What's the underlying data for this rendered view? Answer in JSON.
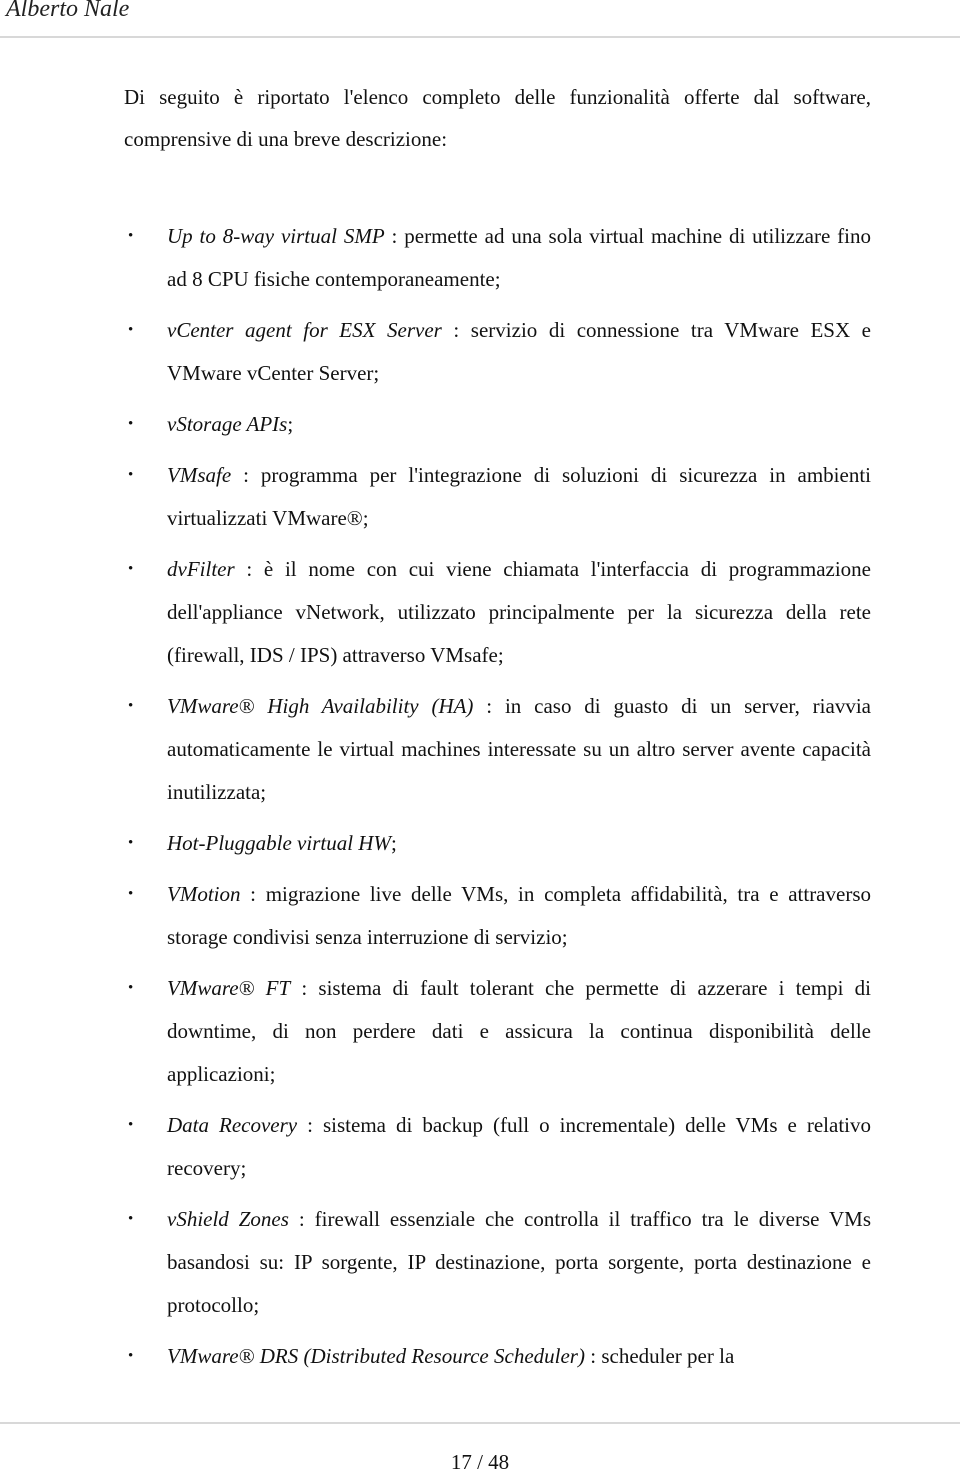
{
  "header": {
    "author": "Alberto Nale"
  },
  "intro": "Di seguito è riportato l'elenco completo delle funzionalità offerte dal software, comprensive di una breve descrizione:",
  "features": [
    {
      "term": "Up to 8-way virtual SMP",
      "sep": " : ",
      "desc": "permette ad una sola virtual machine di utilizzare fino ad 8 CPU fisiche contemporaneamente;"
    },
    {
      "term": "vCenter agent for ESX Server",
      "sep": " : ",
      "desc": "servizio di connessione tra VMware ESX e VMware vCenter Server;"
    },
    {
      "term": "vStorage APIs",
      "sep": "",
      "desc": ";"
    },
    {
      "term": "VMsafe",
      "sep": " : ",
      "desc": "programma per l'integrazione di soluzioni di sicurezza in ambienti virtualizzati VMware®;"
    },
    {
      "term": "dvFilter",
      "sep": " : ",
      "desc": "è il nome con cui viene chiamata l'interfaccia di programmazione dell'appliance vNetwork, utilizzato principalmente per la sicurezza della rete (firewall, IDS / IPS) attraverso VMsafe;"
    },
    {
      "term": "VMware® High Availability (HA)",
      "sep": " : ",
      "desc": "in caso di guasto di un server, riavvia automaticamente le virtual machines interessate su un altro server avente capacità inutilizzata;"
    },
    {
      "term": "Hot-Pluggable virtual HW",
      "sep": "",
      "desc": ";"
    },
    {
      "term": "VMotion",
      "sep": " : ",
      "desc": "migrazione live delle VMs, in completa affidabilità, tra e attraverso storage condivisi senza interruzione di servizio;"
    },
    {
      "term": "VMware® FT",
      "sep": " : ",
      "desc": "sistema di fault tolerant che permette di azzerare i tempi di downtime, di non perdere dati e assicura la continua disponibilità delle applicazioni;"
    },
    {
      "term": "Data Recovery",
      "sep": " : ",
      "desc": "sistema di backup (full o incrementale) delle VMs e relativo recovery;"
    },
    {
      "term": "vShield Zones",
      "sep": " : ",
      "desc": "firewall essenziale che controlla il traffico tra le diverse VMs basandosi su: IP sorgente, IP destinazione, porta sorgente, porta destinazione e protocollo;"
    },
    {
      "term": "VMware® DRS (Distributed Resource Scheduler)",
      "sep": " : ",
      "desc": "scheduler per la"
    }
  ],
  "bullet_glyph": "•",
  "footer": {
    "page_number": "17 / 48"
  }
}
